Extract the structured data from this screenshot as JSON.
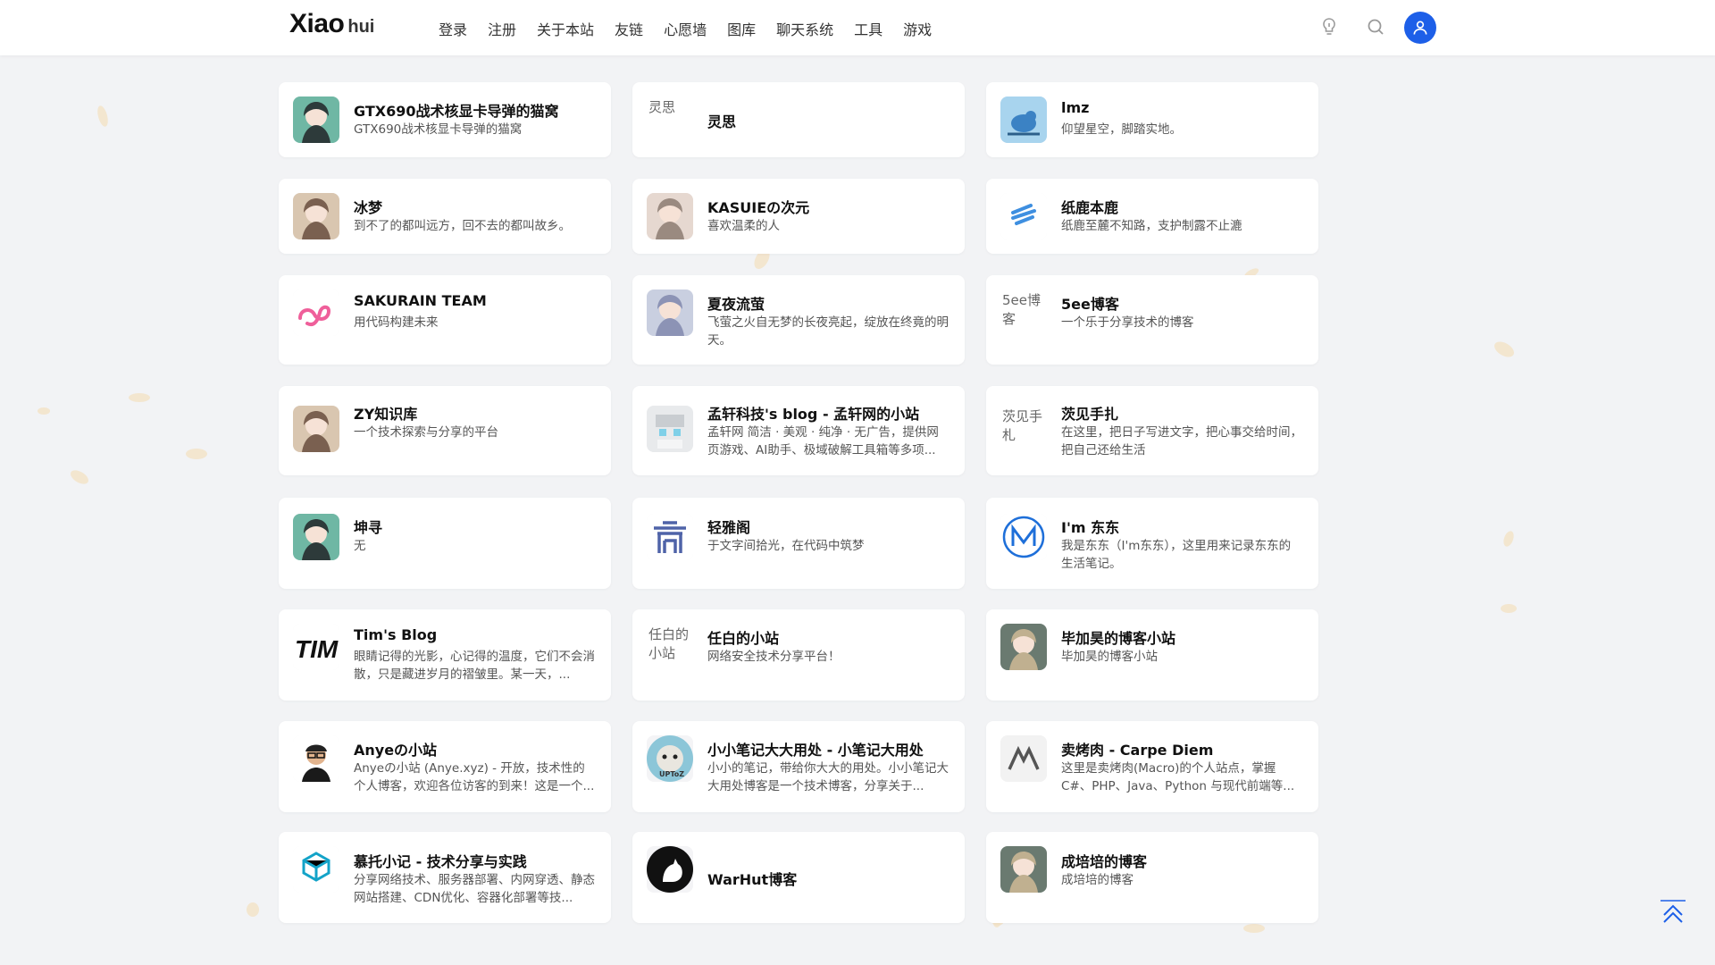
{
  "header": {
    "logo_main": "Xiao",
    "logo_sub": "hui",
    "nav": [
      "登录",
      "注册",
      "关于本站",
      "友链",
      "心愿墙",
      "图库",
      "聊天系统",
      "工具",
      "游戏"
    ]
  },
  "colors": {
    "accent": "#1d5fe8",
    "page_bg": "#f2f3f5",
    "card_bg": "#ffffff"
  },
  "cards": [
    {
      "title": "GTX690战术核显卡导弹的猫窝",
      "desc": "GTX690战术核显卡导弹的猫窝",
      "icon": "anime-girl-icon"
    },
    {
      "title": "灵思",
      "desc": "",
      "icon": "broken-image-icon",
      "alt": "灵思"
    },
    {
      "title": "lmz",
      "desc": "仰望星空，脚踏实地。",
      "icon": "bird-icon"
    },
    {
      "title": "冰梦",
      "desc": "到不了的都叫远方，回不去的都叫故乡。",
      "icon": "anime-girl-icon"
    },
    {
      "title": "KASUIEの次元",
      "desc": "喜欢温柔的人",
      "icon": "anime-girl-icon"
    },
    {
      "title": "纸鹿本鹿",
      "desc": "纸鹿至麓不知路，支护制露不止漉",
      "icon": "blue-layers-icon"
    },
    {
      "title": "SAKURAIN TEAM",
      "desc": "用代码构建未来",
      "icon": "pink-logo-icon"
    },
    {
      "title": "夏夜流萤",
      "desc": "飞萤之火自无梦的长夜亮起，绽放在终竟的明天。",
      "icon": "anime-girl-icon"
    },
    {
      "title": "5ee博客",
      "desc": "一个乐于分享技术的博客",
      "icon": "broken-image-icon",
      "alt": "5ee博客"
    },
    {
      "title": "ZY知识库",
      "desc": "一个技术探索与分享的平台",
      "icon": "anime-girl-icon"
    },
    {
      "title": "孟轩科技's blog - 孟轩网的小站",
      "desc": "孟轩网 简洁 · 美观 · 纯净 · 无广告，提供网页游戏、AI助手、极域破解工具箱等多项...",
      "icon": "pixel-avatar-icon"
    },
    {
      "title": "茨见手扎",
      "desc": "在这里，把日子写进文字，把心事交给时间，把自己还给生活",
      "icon": "broken-image-icon",
      "alt": "茨见手札"
    },
    {
      "title": "坤寻",
      "desc": "无",
      "icon": "anime-girl-icon"
    },
    {
      "title": "轻雅阁",
      "desc": "于文字间拾光，在代码中筑梦",
      "icon": "pavilion-icon"
    },
    {
      "title": "I'm 东东",
      "desc": "我是东东（I'm东东），这里用来记录东东的生活笔记。",
      "icon": "m-logo-icon"
    },
    {
      "title": "Tim's Blog",
      "desc": "眼睛记得的光影，心记得的温度，它们不会消散，只是藏进岁月的褶皱里。某一天，...",
      "icon": "tim-logo-icon"
    },
    {
      "title": "任白的小站",
      "desc": "网络安全技术分享平台！",
      "icon": "broken-image-icon",
      "alt": "任白的小站"
    },
    {
      "title": "毕加昊的博客小站",
      "desc": "毕加昊的博客小站",
      "icon": "anime-girl-icon"
    },
    {
      "title": "Anyeの小站",
      "desc": "Anyeの小站 (Anye.xyz) - 开放，技术性的个人博客，欢迎各位访客的到来！这是一个...",
      "icon": "person-avatar-icon"
    },
    {
      "title": "小小笔记大大用处 - 小笔记大用处",
      "desc": "小小的笔记，带给你大大的用处。小小笔记大大用处博客是一个技术博客，分享关于...",
      "icon": "animal-avatar-icon"
    },
    {
      "title": "卖烤肉 - Carpe Diem",
      "desc": "这里是卖烤肉(Macro)的个人站点，掌握 C#、PHP、Java、Python 与现代前端等...",
      "icon": "m-mark-icon"
    },
    {
      "title": "慕托小记 - 技术分享与实践",
      "desc": "分享网络技术、服务器部署、内网穿透、静态网站搭建、CDN优化、容器化部署等技...",
      "icon": "cube-logo-icon"
    },
    {
      "title": "WarHut博客",
      "desc": "",
      "icon": "cat-silhouette-icon"
    },
    {
      "title": "成培培的博客",
      "desc": "成培培的博客",
      "icon": "anime-girl-icon"
    }
  ]
}
